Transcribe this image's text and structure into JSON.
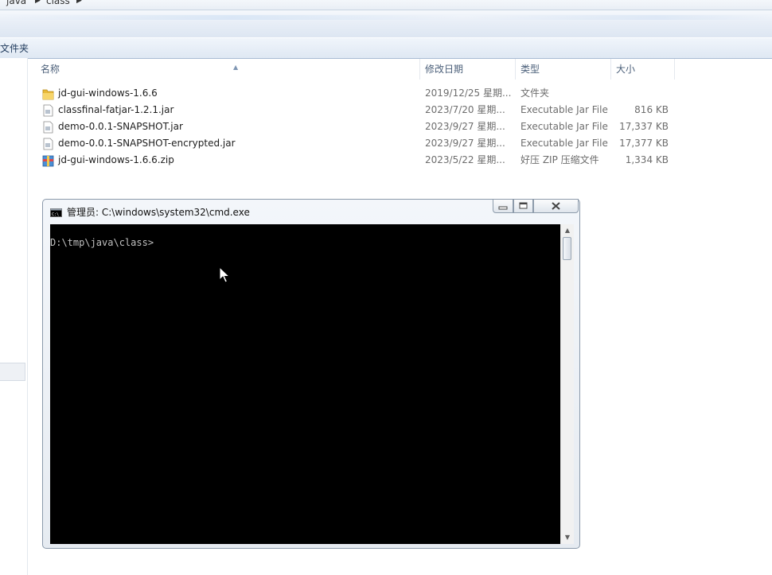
{
  "explorer": {
    "breadcrumb": [
      "java",
      "class"
    ],
    "command_bar_label": "文件夹",
    "columns": {
      "name": "名称",
      "modified": "修改日期",
      "type": "类型",
      "size": "大小"
    },
    "files": [
      {
        "name": "jd-gui-windows-1.6.6",
        "modified": "2019/12/25 星期...",
        "type": "文件夹",
        "size": "",
        "icon": "folder-icon"
      },
      {
        "name": "classfinal-fatjar-1.2.1.jar",
        "modified": "2023/7/20 星期...",
        "type": "Executable Jar File",
        "size": "816 KB",
        "icon": "jar-file-icon"
      },
      {
        "name": "demo-0.0.1-SNAPSHOT.jar",
        "modified": "2023/9/27 星期...",
        "type": "Executable Jar File",
        "size": "17,337 KB",
        "icon": "jar-file-icon"
      },
      {
        "name": "demo-0.0.1-SNAPSHOT-encrypted.jar",
        "modified": "2023/9/27 星期...",
        "type": "Executable Jar File",
        "size": "17,377 KB",
        "icon": "jar-file-icon"
      },
      {
        "name": "jd-gui-windows-1.6.6.zip",
        "modified": "2023/5/22 星期...",
        "type": "好压 ZIP 压缩文件",
        "size": "1,334 KB",
        "icon": "zip-archive-icon"
      }
    ]
  },
  "cmd": {
    "title": "管理员: C:\\windows\\system32\\cmd.exe",
    "prompt": "D:\\tmp\\java\\class>",
    "colors": {
      "background": "#000000",
      "text": "#c0c0c0"
    }
  }
}
